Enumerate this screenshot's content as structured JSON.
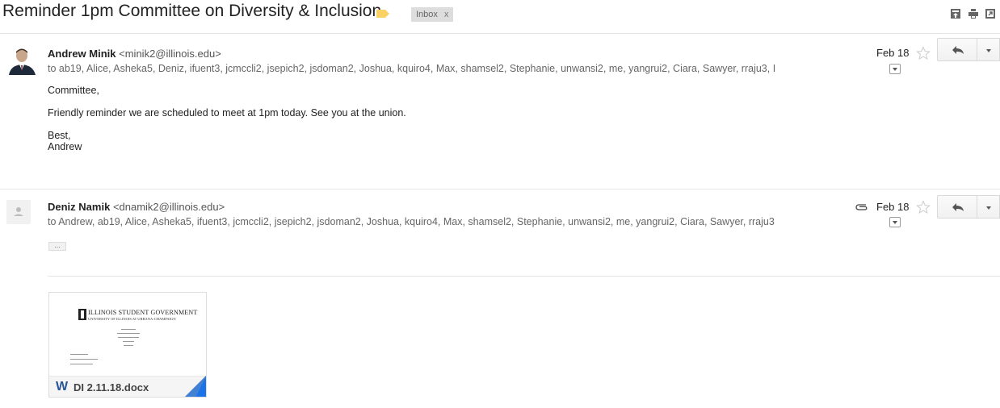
{
  "thread": {
    "subject": "Reminder 1pm Committee on Diversity & Inclusion",
    "label": "Inbox",
    "label_close": "x"
  },
  "toolbar_icons": [
    "archive-icon",
    "print-icon",
    "new-window-icon"
  ],
  "messages": [
    {
      "sender_name": "Andrew Minik",
      "sender_email": "<minik2@illinois.edu>",
      "recipients": "to ab19, Alice, Asheka5, Deniz, ifuent3, jcmccli2, jsepich2, jsdoman2, Joshua, kquiro4, Max, shamsel2, Stephanie, unwansi2, me, yangrui2, Ciara, Sawyer, rraju3, I",
      "date": "Feb 18",
      "body": {
        "greeting": "Committee,",
        "text": "Friendly reminder we are scheduled to meet at 1pm today. See you at the union.",
        "signoff": "Best,",
        "signature": "Andrew"
      }
    },
    {
      "sender_name": "Deniz Namik",
      "sender_email": "<dnamik2@illinois.edu>",
      "recipients": "to Andrew, ab19, Alice, Asheka5, ifuent3, jcmccli2, jsepich2, jsdoman2, Joshua, kquiro4, Max, shamsel2, Stephanie, unwansi2, me, yangrui2, Ciara, Sawyer, rraju3",
      "date": "Feb 18",
      "has_attachment": true,
      "trimmed_content": "...",
      "attachment": {
        "filename": "DI 2.11.18.docx",
        "type_letter": "W",
        "preview_title": "ILLINOIS STUDENT GOVERNMENT",
        "preview_subtitle": "UNIVERSITY OF ILLINOIS AT URBANA-CHAMPAIGN"
      }
    }
  ],
  "colors": {
    "label_tag": "#fad165",
    "word_blue": "#2a5699",
    "fold_blue": "#1a73e8"
  }
}
